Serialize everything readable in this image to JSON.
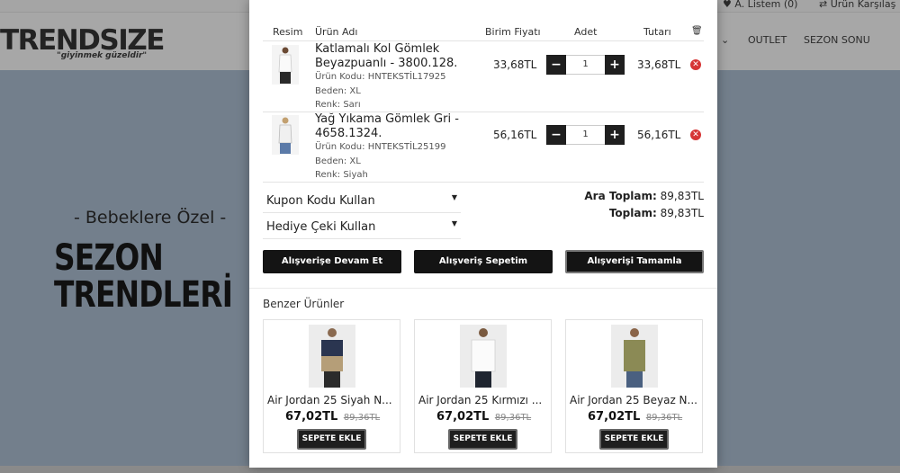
{
  "background": {
    "topbar": {
      "wishlist": "A. Listem (0)",
      "compare": "Ürün Karşılaş"
    },
    "logo": {
      "name": "TRENDSIZE",
      "tagline": "\"giyinmek güzeldir\""
    },
    "nav": [
      "OUTLET",
      "SEZON SONU"
    ],
    "hero": {
      "subtitle": "- Bebeklere Özel -",
      "line1": "SEZON",
      "line2": "TRENDLERİ"
    }
  },
  "cart": {
    "headers": {
      "image": "Resim",
      "name": "Ürün Adı",
      "unit_price": "Birim Fiyatı",
      "qty": "Adet",
      "total": "Tutarı",
      "delete_icon": "trash-icon"
    },
    "items": [
      {
        "name": "Katlamalı Kol Gömlek Beyazpuanlı - 3800.128.",
        "code": "Ürün Kodu: HNTEKSTİL17925",
        "size": "Beden: XL",
        "color": "Renk: Sarı",
        "unit_price": "33,68TL",
        "qty": "1",
        "total": "33,68TL"
      },
      {
        "name": "Yağ Yıkama Gömlek Gri - 4658.1324.",
        "code": "Ürün Kodu: HNTEKSTİL25199",
        "size": "Beden: XL",
        "color": "Renk: Siyah",
        "unit_price": "56,16TL",
        "qty": "1",
        "total": "56,16TL"
      }
    ],
    "coupon_label": "Kupon Kodu Kullan",
    "gift_label": "Hediye Çeki Kullan",
    "subtotal_label": "Ara Toplam:",
    "subtotal_value": "89,83TL",
    "total_label": "Toplam:",
    "total_value": "89,83TL",
    "buttons": {
      "continue": "Alışverişe Devam Et",
      "cart": "Alışveriş Sepetim",
      "checkout": "Alışverişi Tamamla"
    }
  },
  "similar": {
    "title": "Benzer Ürünler",
    "add_label": "SEPETE EKLE",
    "items": [
      {
        "name": "Air Jordan 25 Siyah N...",
        "price": "67,02TL",
        "old_price": "89,36TL"
      },
      {
        "name": "Air Jordan 25 Kırmızı ...",
        "price": "67,02TL",
        "old_price": "89,36TL"
      },
      {
        "name": "Air Jordan 25 Beyaz N...",
        "price": "67,02TL",
        "old_price": "89,36TL"
      }
    ]
  },
  "colors": {
    "button_dark": "#141414",
    "remove_red": "#d63636",
    "overlay": "#747f8c"
  }
}
